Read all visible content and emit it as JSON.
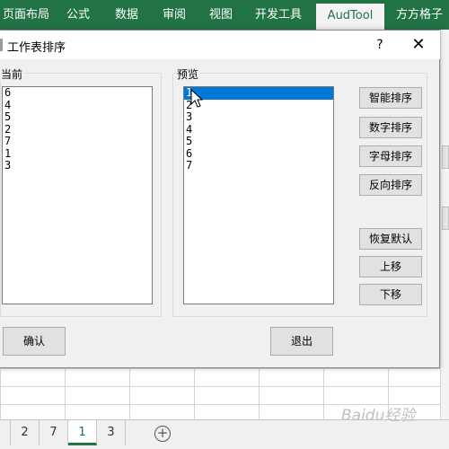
{
  "ribbon": {
    "tabs": [
      "页面布局",
      "公式",
      "数据",
      "审阅",
      "视图",
      "开发工具",
      "AudTool",
      "方方格子"
    ],
    "active_tab": "AudTool"
  },
  "dialog": {
    "title": "工作表排序",
    "help_label": "?",
    "close_label": "✕",
    "current_group_label": "当前",
    "current_items": [
      "6",
      "4",
      "5",
      "2",
      "7",
      "1",
      "3"
    ],
    "preview_group_label": "预览",
    "preview_items": [
      "1",
      "2",
      "3",
      "4",
      "5",
      "6",
      "7"
    ],
    "preview_selected_index": 0,
    "buttons": {
      "smart_sort": "智能排序",
      "numeric_sort": "数字排序",
      "alpha_sort": "字母排序",
      "reverse_sort": "反向排序",
      "restore_default": "恢复默认",
      "move_up": "上移",
      "move_down": "下移",
      "confirm": "确认",
      "exit": "退出"
    }
  },
  "sheet_tabs": [
    "2",
    "7",
    "1",
    "3"
  ],
  "active_sheet": "1",
  "add_sheet_symbol": "+",
  "watermark": "Baidu经验",
  "colors": {
    "ribbon_green": "#217346",
    "selection_blue": "#0078d7",
    "dialog_bg": "#f0f0f0"
  }
}
